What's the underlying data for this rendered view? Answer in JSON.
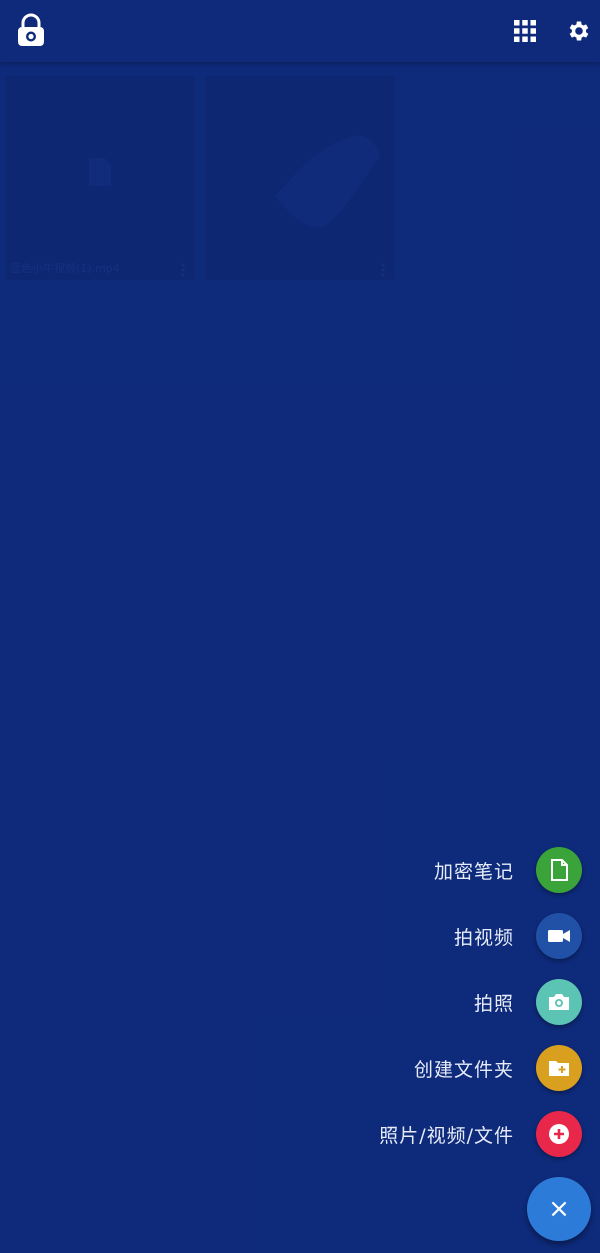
{
  "toolbar": {
    "app_icon": "camera-lock-icon",
    "grid_icon": "grid-icon",
    "settings_icon": "gear-icon"
  },
  "files": [
    {
      "label": "蓝色小牛视频(1).mp4",
      "icon": "file-icon"
    },
    {
      "label": "",
      "icon": "image-thumbnail"
    }
  ],
  "fab_menu": [
    {
      "label": "加密笔记",
      "icon": "note-icon",
      "color": "#3aa33a"
    },
    {
      "label": "拍视频",
      "icon": "videocam-icon",
      "color": "#2151a6"
    },
    {
      "label": "拍照",
      "icon": "camera-icon",
      "color": "#5cc4b4"
    },
    {
      "label": "创建文件夹",
      "icon": "folder-add-icon",
      "color": "#d9a020"
    },
    {
      "label": "照片/视频/文件",
      "icon": "add-circle-icon",
      "color": "#e8274a"
    }
  ],
  "fab_main": {
    "label": "×",
    "icon": "close-icon",
    "color": "#2d7bd9"
  },
  "theme": {
    "background": "#0f2a7a"
  }
}
